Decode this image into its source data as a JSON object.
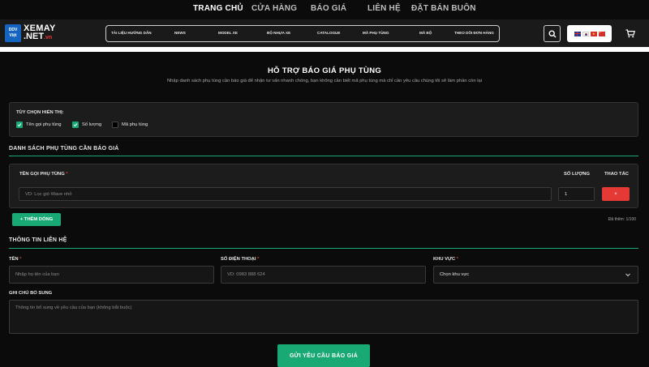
{
  "topnav": [
    "TRANG CHỦ",
    "CỬA HÀNG",
    "BÁO GIÁ",
    "LIÊN HỆ",
    "ĐẶT BÁN BUÔN"
  ],
  "logo": {
    "badge_top": "DDV",
    "badge_bottom": "Việt",
    "line1": "XEMAY",
    "line2": ".NET",
    "suffix": ".vn"
  },
  "menu": [
    "TÀI LIỆU HƯỚNG DẪN",
    "NEWS",
    "MODEL XE",
    "BỘ NHỰA XE",
    "CATALOGUE",
    "MÃ PHỤ TÙNG",
    "MÃ BỘ",
    "THEO DÕI ĐƠN HÀNG"
  ],
  "icons": {
    "search": "search-icon",
    "cart": "cart-icon"
  },
  "page": {
    "title": "HỖ TRỢ BÁO GIÁ PHỤ TÙNG",
    "subtitle": "Nhập danh sách phụ tùng cần báo giá để nhận tư vấn nhanh chóng, bạn không cần biết mã phụ tùng mà chỉ cần yêu cầu chúng tôi sẽ làm phần còn lại"
  },
  "options": {
    "title": "TÙY CHỌN HIỂN THỊ:",
    "items": [
      {
        "label": "Tên gọi phụ tùng",
        "checked": true
      },
      {
        "label": "Số lượng",
        "checked": true
      },
      {
        "label": "Mã phụ tùng",
        "checked": false
      }
    ]
  },
  "parts": {
    "section_title": "DANH SÁCH PHỤ TÙNG CẦN BÁO GIÁ",
    "col_name": "TÊN GỌI PHỤ TÙNG",
    "required_mark": "*",
    "col_qty": "SỐ LƯỢNG",
    "col_action": "THAO TÁC",
    "name_placeholder": "VD: Lọc gió Wave nhỏ",
    "qty_value": "1",
    "delete_label": "×",
    "add_label": "+ THÊM DÒNG",
    "count_text": "Đã thêm: 1/100"
  },
  "contact": {
    "section_title": "THÔNG TIN LIÊN HỆ",
    "name_label": "TÊN",
    "name_placeholder": "Nhập họ tên của bạn",
    "phone_label": "SỐ ĐIỆN THOẠI",
    "phone_placeholder": "VD: 0983 888 624",
    "region_label": "KHU VỰC",
    "region_value": "Chọn khu vực",
    "note_label": "GHI CHÚ BỔ SUNG",
    "note_placeholder": "Thông tin bổ sung về yêu cầu của bạn (không bắt buộc)"
  },
  "submit_label": "GỬI YÊU CẦU BÁO GIÁ",
  "colors": {
    "accent": "#19a974",
    "danger": "#e53935",
    "panel": "#1c1c1c"
  }
}
